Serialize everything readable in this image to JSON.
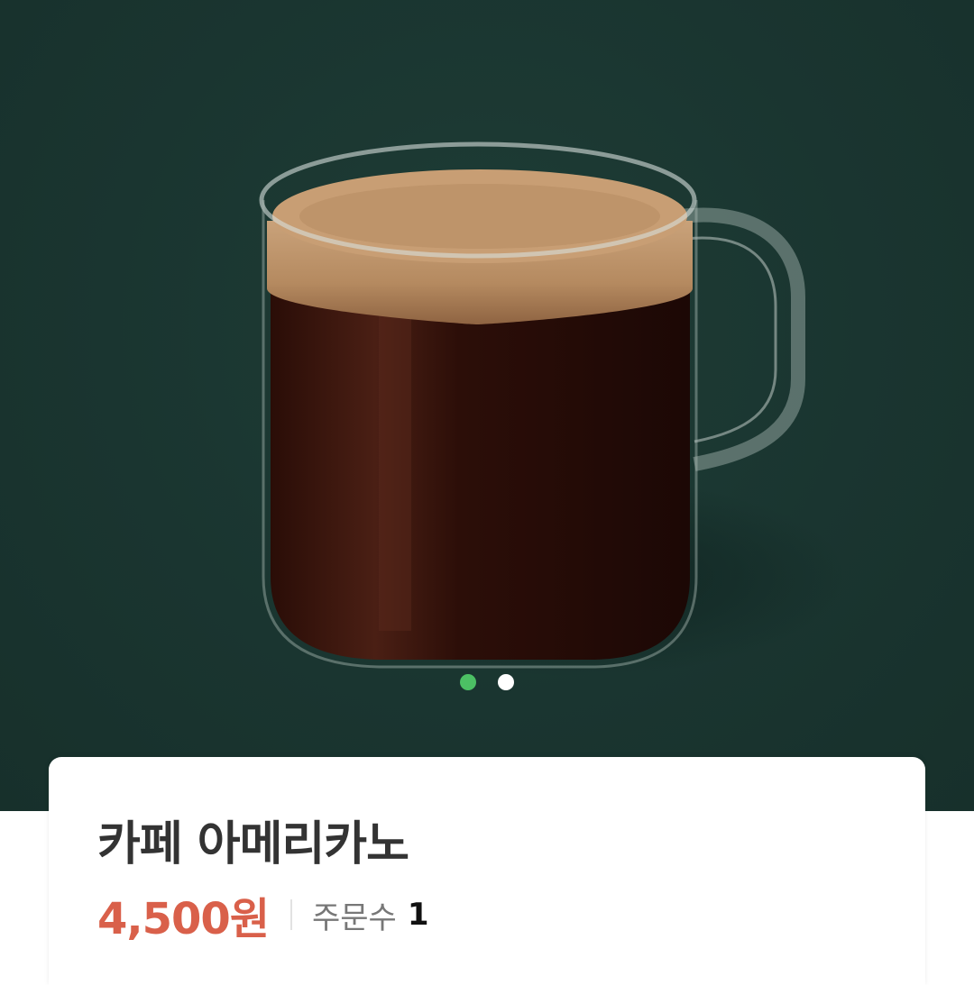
{
  "product": {
    "image_alt": "카페 아메리카노 glass mug",
    "name": "카페 아메리카노",
    "price": "4,500원",
    "order_label": "주문수",
    "order_count": "1"
  },
  "carousel": {
    "total_slides": 2,
    "active_index": 0,
    "active_color": "#4cc064",
    "inactive_color": "#ffffff"
  },
  "colors": {
    "background": "#1a3530",
    "price": "#d9604a",
    "title": "#333333"
  }
}
